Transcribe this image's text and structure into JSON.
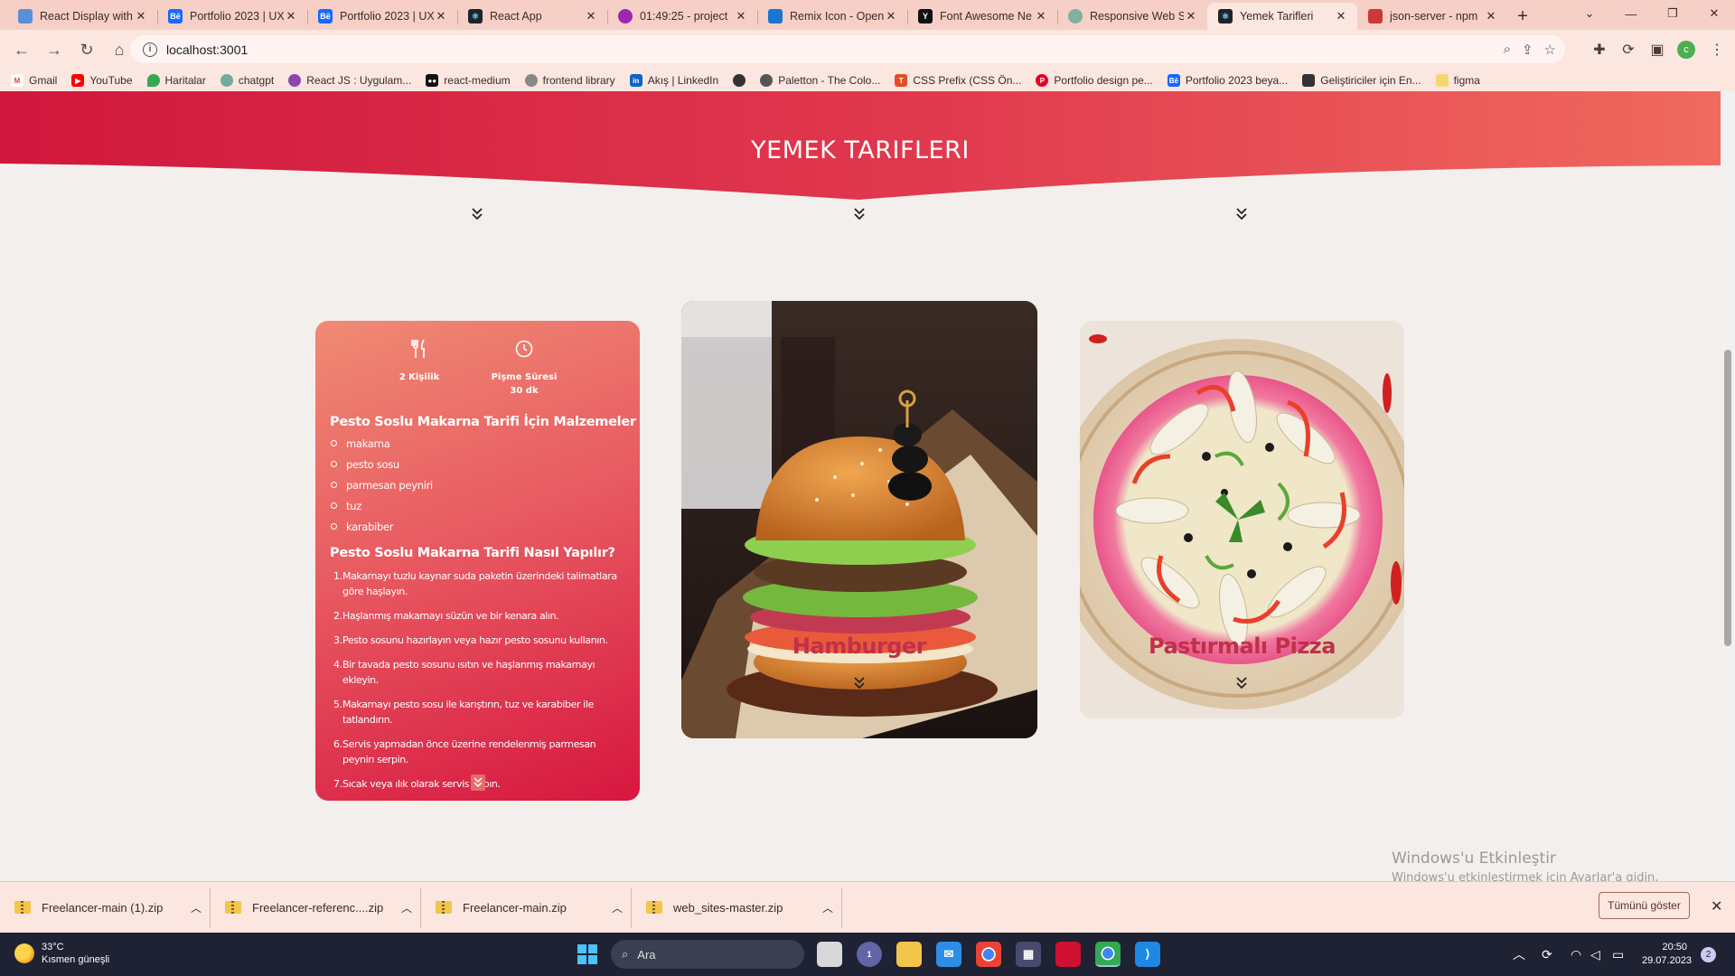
{
  "browser": {
    "tabs": [
      {
        "title": "React Display with",
        "fav_color": "#5a8fd8",
        "fav_text": ""
      },
      {
        "title": "Portfolio 2023 | UX",
        "fav_color": "#1769ff",
        "fav_text": "Bē"
      },
      {
        "title": "Portfolio 2023 | UX",
        "fav_color": "#1769ff",
        "fav_text": "Bē"
      },
      {
        "title": "React App",
        "fav_color": "#20232a",
        "fav_text": ""
      },
      {
        "title": "01:49:25 - project",
        "fav_color": "#9c27b0",
        "fav_text": ""
      },
      {
        "title": "Remix Icon - Open",
        "fav_color": "#1976d2",
        "fav_text": ""
      },
      {
        "title": "Font Awesome Ne",
        "fav_color": "#111111",
        "fav_text": "Y"
      },
      {
        "title": "Responsive Web S",
        "fav_color": "#7fb0a0",
        "fav_text": ""
      },
      {
        "title": "Yemek Tarifleri",
        "fav_color": "#20232a",
        "fav_text": ""
      },
      {
        "title": "json-server - npm",
        "fav_color": "#cb3837",
        "fav_text": ""
      }
    ],
    "new_tab": "+",
    "url": "localhost:3001",
    "profile_initial": "c",
    "bookmarks": [
      {
        "label": "Gmail",
        "color": "#ea4335",
        "text": "M"
      },
      {
        "label": "YouTube",
        "color": "#ff0000",
        "text": "▶"
      },
      {
        "label": "Haritalar",
        "color": "#34a853",
        "text": ""
      },
      {
        "label": "chatgpt",
        "color": "#74aa9c",
        "text": ""
      },
      {
        "label": "React JS : Uygulam...",
        "color": "#8e44ad",
        "text": ""
      },
      {
        "label": "react-medium",
        "color": "#111111",
        "text": ""
      },
      {
        "label": "frontend library",
        "color": "#888888",
        "text": ""
      },
      {
        "label": "Akış | LinkedIn",
        "color": "#0a66c2",
        "text": "in"
      },
      {
        "label": "",
        "color": "#333333",
        "text": ""
      },
      {
        "label": "Paletton - The Colo...",
        "color": "#555555",
        "text": ""
      },
      {
        "label": "CSS Prefix (CSS Ön...",
        "color": "#e44d26",
        "text": "T"
      },
      {
        "label": "Portfolio design pe...",
        "color": "#e60023",
        "text": "P"
      },
      {
        "label": "Portfolio 2023 beya...",
        "color": "#1769ff",
        "text": "Bē"
      },
      {
        "label": "Geliştiriciler için En...",
        "color": "#333333",
        "text": ""
      },
      {
        "label": "figma",
        "color": "#f5d76e",
        "text": ""
      }
    ]
  },
  "page": {
    "hero_title": "YEMEK TARIFLERI",
    "recipe": {
      "servings": "2 Kişilik",
      "cook_label": "Pişme Süresi",
      "cook_time": "30 dk",
      "ingredients_title": "Pesto Soslu Makarna Tarifi İçin Malzemeler",
      "ingredients": [
        "makarna",
        "pesto sosu",
        "parmesan peyniri",
        "tuz",
        "karabiber"
      ],
      "steps_title": "Pesto Soslu Makarna Tarifi Nasıl Yapılır?",
      "steps": [
        {
          "no": "1.",
          "text": "Makarnayı tuzlu kaynar suda paketin üzerindeki talimatlara göre haşlayın."
        },
        {
          "no": "2.",
          "text": "Haşlanmış makarnayı süzün ve bir kenara alın."
        },
        {
          "no": "3.",
          "text": "Pesto sosunu hazırlayın veya hazır pesto sosunu kullanın."
        },
        {
          "no": "4.",
          "text": "Bir tavada pesto sosunu ısıtın ve haşlanmış makarnayı ekleyin."
        },
        {
          "no": "5.",
          "text": "Makarnayı pesto sosu ile karıştırın, tuz ve karabiber ile tatlandırın."
        },
        {
          "no": "6.",
          "text": "Servis yapmadan önce üzerine rendelenmiş parmesan peynirı serpin."
        },
        {
          "no": "7.",
          "text": "Sıcak veya ılık olarak servis yapın."
        }
      ]
    },
    "cards": [
      {
        "title": "Hamburger"
      },
      {
        "title": "Pastırmalı Pizza"
      }
    ],
    "colors": {
      "accent": "#d7163f",
      "title": "#c0304a",
      "background": "#f3efec"
    }
  },
  "downloads": {
    "items": [
      "Freelancer-main (1).zip",
      "Freelancer-referenc....zip",
      "Freelancer-main.zip",
      "web_sites-master.zip"
    ],
    "show_all": "Tümünü göster"
  },
  "watermark": {
    "line1": "Windows'u Etkinleştir",
    "line2": "Windows'u etkinleştirmek için Ayarlar'a gidin."
  },
  "taskbar": {
    "temp": "33°C",
    "weather": "Kısmen güneşli",
    "search": "Ara",
    "time": "20:50",
    "date": "29.07.2023",
    "notifications": "2",
    "chat_badge": "1"
  }
}
